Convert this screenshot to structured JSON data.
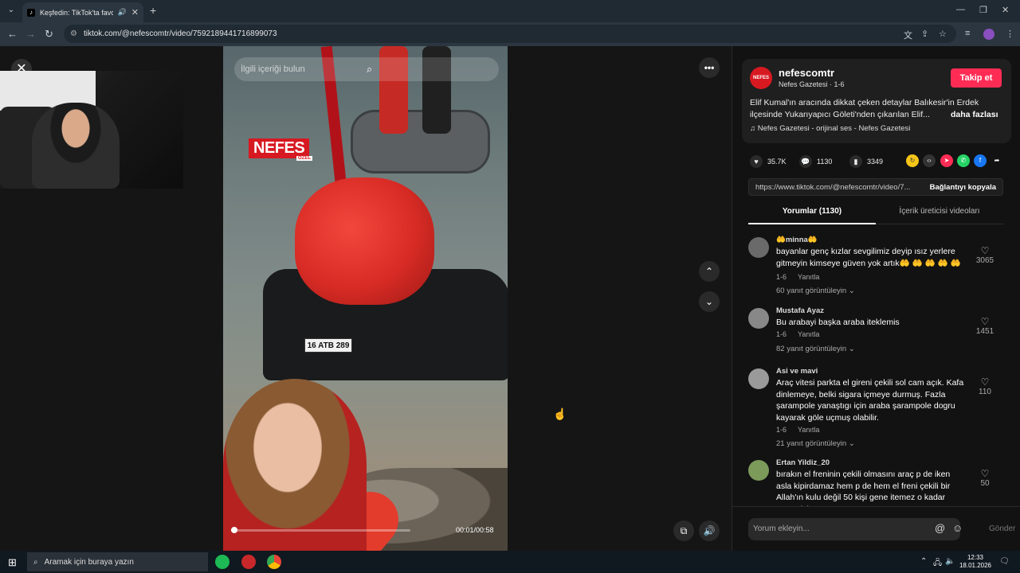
{
  "browser": {
    "tab_title": "Keşfedin: TikTok'ta favori vi",
    "url": "tiktok.com/@nefescomtr/video/7592189441716899073"
  },
  "video": {
    "search_placeholder": "İlgili içeriği bulun",
    "logo_text": "NEFES",
    "logo_sub": "ÖZEL",
    "plate": "16 ATB 289",
    "timestamp": "00:01/00:58",
    "progress_fraction": 0.017
  },
  "author": {
    "avatar_text": "NEFES",
    "name": "nefescomtr",
    "subtitle": "Nefes Gazetesi · 1-6",
    "follow_label": "Takip et",
    "description": "Elif Kumal'ın aracında dikkat çeken detaylar Balıkesir'in Erdek ilçesinde Yukarıyapıcı Göleti'nden çıkarılan Elif...",
    "more_label": "daha fazlası",
    "music": "Nefes Gazetesi - orijinal ses - Nefes Gazetesi"
  },
  "stats": {
    "likes": "35.7K",
    "comments": "1130",
    "saves": "3349"
  },
  "share_link": {
    "url": "https://www.tiktok.com/@nefescomtr/video/7...",
    "copy_label": "Bağlantıyı kopyala"
  },
  "tabs": {
    "comments": "Yorumlar (1130)",
    "creator_videos": "İçerik üreticisi videoları"
  },
  "comments": [
    {
      "user": "🤲minna🤲",
      "text": "bayanlar genç kızlar sevgilimiz deyip ısız yerlere gitmeyin kimseye güven yok artık🤲 🤲 🤲 🤲 🤲",
      "date": "1-6",
      "reply": "Yanıtla",
      "replies": "60 yanıt görüntüleyin",
      "likes": "3065"
    },
    {
      "user": "Mustafa Ayaz",
      "text": "Bu arabayi başka araba iteklemis",
      "date": "1-6",
      "reply": "Yanıtla",
      "replies": "82 yanıt görüntüleyin",
      "likes": "1451"
    },
    {
      "user": "Asi ve mavi",
      "text": "Araç vitesi parkta el gireni çekili sol cam açık. Kafa dinlemeye, belki sigara içmeye durmuş. Fazla şarampole yanaştıgı için araba şarampole dogru kayarak göle uçmuş olabilir.",
      "date": "1-6",
      "reply": "Yanıtla",
      "replies": "21 yanıt görüntüleyin",
      "likes": "110"
    },
    {
      "user": "Ertan Yildiz_20",
      "text": "bırakın el freninin çekili olmasını araç p de iken asla kipirdamaz hem p de hem el freni çekili bir Allah'ın kulu değil 50 kişi gene itemez o kadar suyun içine o",
      "likes": "50"
    }
  ],
  "comment_input": {
    "placeholder": "Yorum ekleyin...",
    "send_label": "Gönder"
  },
  "taskbar": {
    "search_placeholder": "Aramak için buraya yazın",
    "time": "12:33",
    "date": "18.01.2026"
  },
  "colors": {
    "follow": "#fe2c55",
    "brand_red": "#d71921"
  }
}
